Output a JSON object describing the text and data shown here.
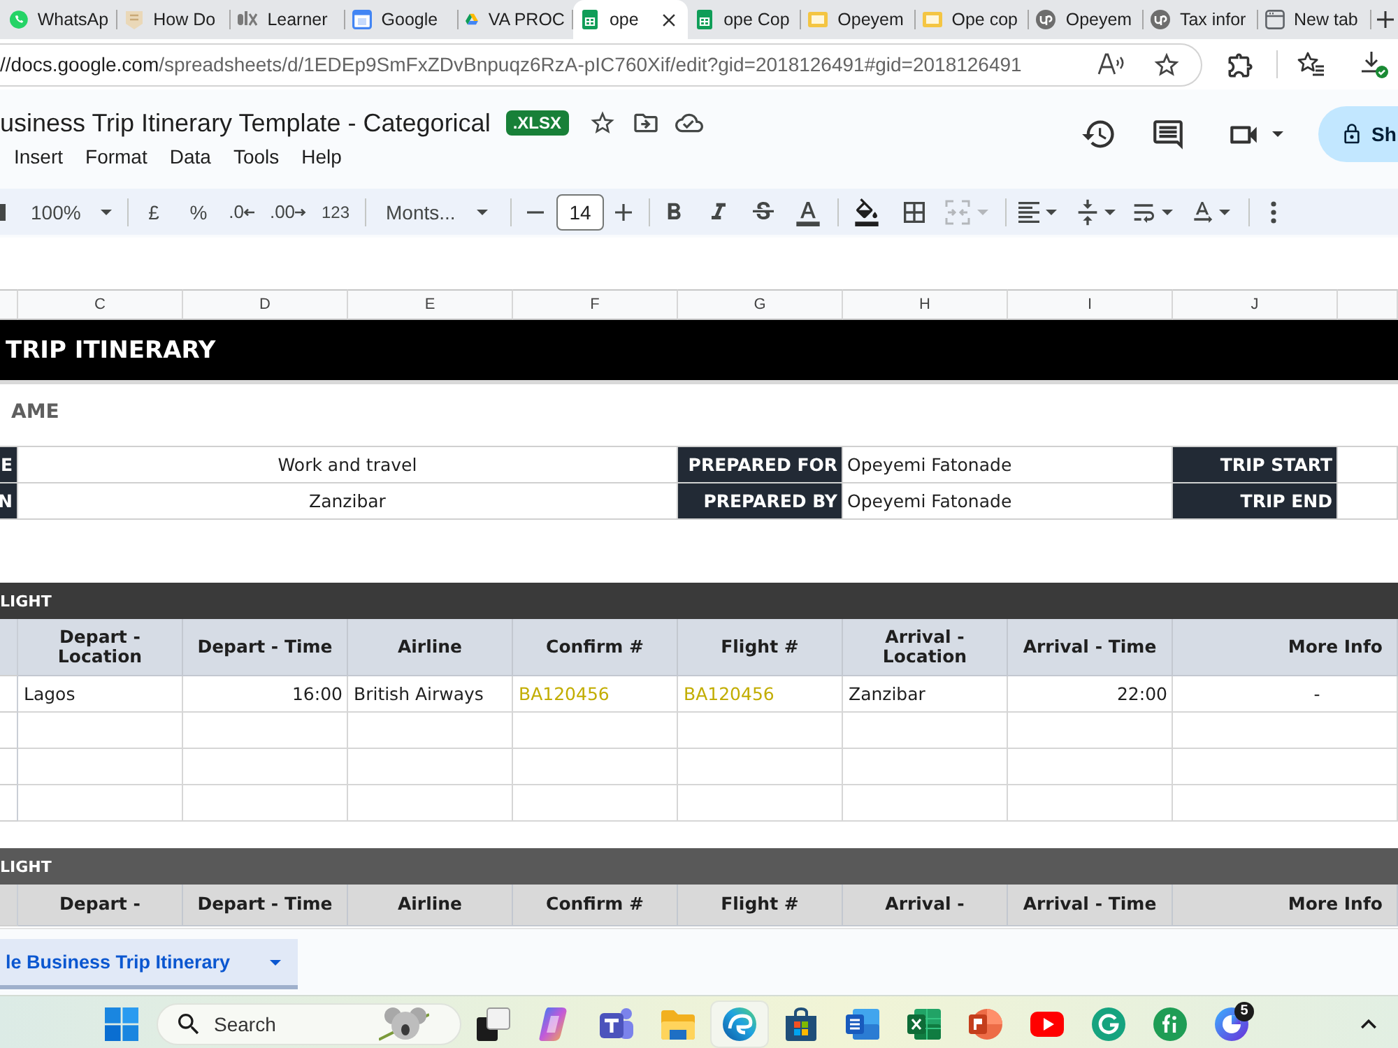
{
  "browser": {
    "tabs": [
      {
        "label": "WhatsAp",
        "kind": "whatsapp",
        "selected": false
      },
      {
        "label": "How Do",
        "kind": "generic",
        "selected": false
      },
      {
        "label": "Learner",
        "kind": "alx",
        "selected": false
      },
      {
        "label": "Google",
        "kind": "calendar",
        "selected": false
      },
      {
        "label": "VA PROC",
        "kind": "drive",
        "selected": false
      },
      {
        "label": "ope",
        "kind": "sheets",
        "selected": true
      },
      {
        "label": "ope Cop",
        "kind": "sheets",
        "selected": false
      },
      {
        "label": "Opeyem",
        "kind": "slides",
        "selected": false
      },
      {
        "label": "Ope cop",
        "kind": "slides",
        "selected": false
      },
      {
        "label": "Opeyem",
        "kind": "upwork",
        "selected": false
      },
      {
        "label": "Tax infor",
        "kind": "upwork",
        "selected": false
      },
      {
        "label": "New tab",
        "kind": "newtab",
        "selected": false
      }
    ],
    "address": {
      "host": "//docs.google.com",
      "path": "/spreadsheets/d/1EDEp9SmFxZDvBnpuqz6RzA-pIC760Xif/edit?gid=2018126491#gid=2018126491"
    }
  },
  "document": {
    "title": "usiness Trip Itinerary Template - Categorical",
    "file_type": ".XLSX",
    "menu": [
      "Insert",
      "Format",
      "Data",
      "Tools",
      "Help"
    ],
    "share": "Sh"
  },
  "toolbar": {
    "zoom": "100%",
    "currency": "£",
    "percent": "%",
    "decrease_decimals": ".0",
    "increase_decimals": ".00",
    "number_format": "123",
    "font": "Monts...",
    "font_size": "14",
    "merge": {
      "disabled": true
    }
  },
  "sheet": {
    "columns": [
      "C",
      "D",
      "E",
      "F",
      "G",
      "H",
      "I",
      "J"
    ],
    "title": "TRIP ITINERARY",
    "subtitle": "AME",
    "details": [
      {
        "cells": [
          {
            "kind": "label",
            "text": "E"
          },
          {
            "kind": "value",
            "text": "Work and travel"
          },
          {
            "kind": "label",
            "text": "PREPARED FOR"
          },
          {
            "kind": "value",
            "text": "Opeyemi Fatonade"
          },
          {
            "kind": "label",
            "text": "TRIP START"
          }
        ]
      },
      {
        "cells": [
          {
            "kind": "label",
            "text": "N"
          },
          {
            "kind": "value",
            "text": "Zanzibar"
          },
          {
            "kind": "label",
            "text": "PREPARED BY"
          },
          {
            "kind": "value",
            "text": "Opeyemi Fatonade"
          },
          {
            "kind": "label",
            "text": "TRIP END"
          }
        ]
      }
    ],
    "sections": [
      {
        "heading": "LIGHT",
        "color": "#3a3a3a",
        "header": {
          "color": "#d6dce5",
          "columns": [
            "Depart - Location",
            "Depart - Time",
            "Airline",
            "Confirm #",
            "Flight #",
            "Arrival - Location",
            "Arrival - Time",
            "More Info"
          ]
        },
        "rows": [
          {
            "cells": [
              {
                "text": "Lagos"
              },
              {
                "text": "16:00"
              },
              {
                "text": "British Airways"
              },
              {
                "text": "BA120456",
                "color": "#c2ad00"
              },
              {
                "text": "BA120456",
                "color": "#c2ad00"
              },
              {
                "text": "Zanzibar"
              },
              {
                "text": "22:00"
              },
              {
                "text": "-"
              }
            ]
          }
        ]
      },
      {
        "heading": "LIGHT",
        "color": "#595959",
        "header": {
          "color": "#d9d9d9",
          "columns": [
            "Depart -",
            "Depart - Time",
            "Airline",
            "Confirm #",
            "Flight #",
            "Arrival -",
            "Arrival - Time",
            "More Info"
          ]
        }
      }
    ]
  },
  "sheet_tabs": [
    {
      "label": "le Business Trip Itinerary",
      "selected": true
    }
  ],
  "taskbar": {
    "search": {
      "placeholder": "Search"
    },
    "apps": [
      {
        "kind": "taskview",
        "selected": false
      },
      {
        "kind": "copilot",
        "selected": false
      },
      {
        "kind": "teams",
        "selected": false
      },
      {
        "kind": "explorer",
        "selected": false
      },
      {
        "kind": "edge",
        "selected": true
      },
      {
        "kind": "store",
        "selected": false
      },
      {
        "kind": "word",
        "selected": false
      },
      {
        "kind": "excel",
        "selected": false
      },
      {
        "kind": "powerpoint",
        "selected": false
      },
      {
        "kind": "youtube",
        "selected": false
      },
      {
        "kind": "grammarly",
        "selected": false
      },
      {
        "kind": "fi",
        "selected": false
      },
      {
        "kind": "ring",
        "selected": false,
        "badge": "5"
      }
    ]
  }
}
